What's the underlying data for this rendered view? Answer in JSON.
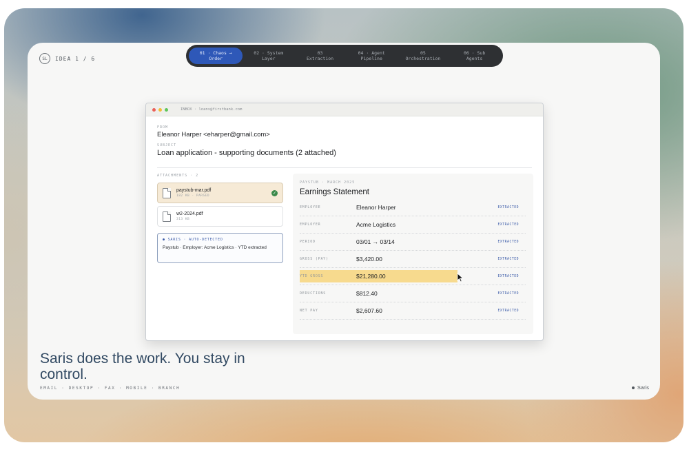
{
  "brand": {
    "mark": "SL",
    "idea": "IDEA 1 / 6"
  },
  "steps": [
    {
      "num": "01 · Chaos →",
      "label": "Order",
      "active": true
    },
    {
      "num": "02 · System",
      "label": "Layer"
    },
    {
      "num": "03",
      "label": "Extraction"
    },
    {
      "num": "04 · Agent",
      "label": "Pipeline"
    },
    {
      "num": "05",
      "label": "Orchestration"
    },
    {
      "num": "06 · Sub",
      "label": "Agents"
    }
  ],
  "window": {
    "titlebar": "INBOX · loans@firstbank.com",
    "from_label": "FROM",
    "from_value": "Eleanor Harper <eharper@gmail.com>",
    "subject_label": "SUBJECT",
    "subject_value": "Loan application - supporting documents (2 attached)",
    "attachments_label": "ATTACHMENTS · 2",
    "files": [
      {
        "name": "paystub-mar.pdf",
        "meta": "182 KB · PARSED"
      },
      {
        "name": "w2-2024.pdf",
        "meta": "313 KB"
      }
    ],
    "saris": {
      "tag": "● SARIS · AUTO-DETECTED",
      "message": "Paystub · Employer: Acme Logistics · YTD extracted"
    },
    "panel": {
      "eyebrow": "PAYSTUB · MARCH 2025",
      "title": "Earnings Statement",
      "rows": [
        {
          "label": "EMPLOYEE",
          "value": "Eleanor Harper",
          "badge": "EXTRACTED"
        },
        {
          "label": "EMPLOYER",
          "value": "Acme Logistics",
          "badge": "EXTRACTED"
        },
        {
          "label": "PERIOD",
          "value": "03/01 → 03/14",
          "badge": "EXTRACTED"
        },
        {
          "label": "GROSS (PAY)",
          "value": "$3,420.00",
          "badge": "EXTRACTED"
        },
        {
          "label": "YTD GROSS",
          "value": "$21,280.00",
          "badge": "EXTRACTED",
          "highlight": true
        },
        {
          "label": "DEDUCTIONS",
          "value": "$812.40",
          "badge": "EXTRACTED"
        },
        {
          "label": "NET PAY",
          "value": "$2,607.60",
          "badge": "EXTRACTED"
        }
      ]
    }
  },
  "headline": "Saris does the work. You stay in control.",
  "channels": "EMAIL · DESKTOP · FAX · MOBILE · BRANCH",
  "footer_brand": "Saris",
  "colors": {
    "accent": "#2e58b8",
    "highlight": "#f7da8e",
    "headline": "#314962"
  },
  "icons": {
    "file": "file-icon",
    "check": "check-icon",
    "cursor": "cursor-icon"
  }
}
